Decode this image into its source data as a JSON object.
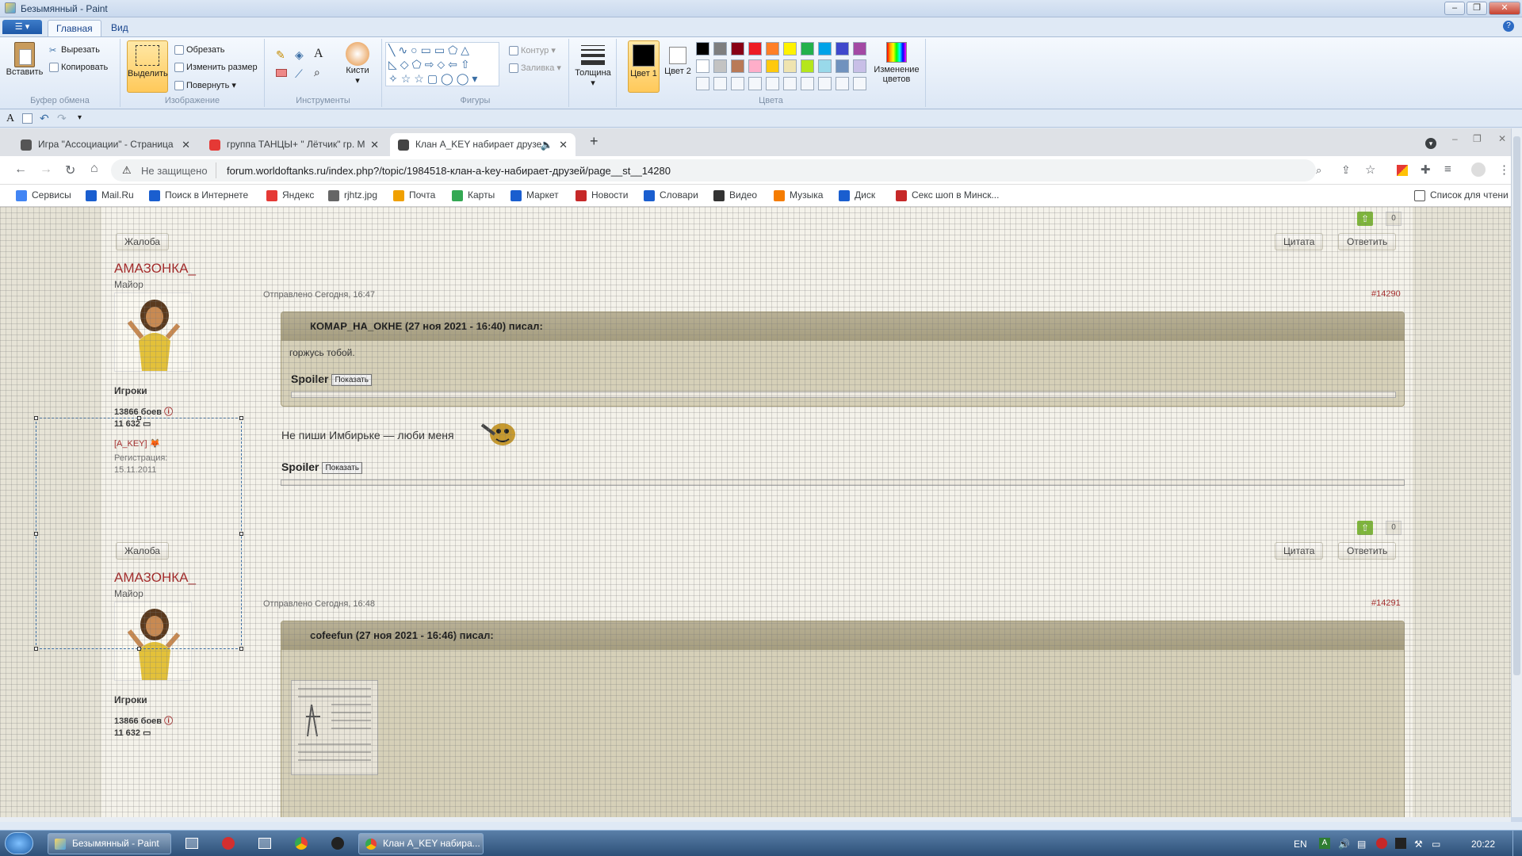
{
  "window": {
    "title": "Безымянный - Paint"
  },
  "ribbon": {
    "file_label": "▾",
    "tabs": [
      "Главная",
      "Вид"
    ],
    "clipboard": {
      "paste": "Вставить",
      "cut": "Вырезать",
      "copy": "Копировать",
      "group": "Буфер обмена"
    },
    "image": {
      "select": "Выделить",
      "crop": "Обрезать",
      "resize": "Изменить размер",
      "rotate": "Повернуть",
      "group": "Изображение"
    },
    "tools": {
      "group": "Инструменты",
      "brushes": "Кисти"
    },
    "shapes": {
      "outline": "Контур",
      "fill": "Заливка",
      "group": "Фигуры"
    },
    "size": {
      "label": "Толщина"
    },
    "colors": {
      "color1": "Цвет 1",
      "color2": "Цвет 2",
      "edit": "Изменение цветов",
      "group": "Цвета",
      "palette_row1": [
        "#000000",
        "#7f7f7f",
        "#880015",
        "#ed1c24",
        "#ff7f27",
        "#fff200",
        "#22b14c",
        "#00a2e8",
        "#3f48cc",
        "#a349a4"
      ],
      "palette_row2": [
        "#ffffff",
        "#c3c3c3",
        "#b97a57",
        "#ffaec9",
        "#ffc90e",
        "#efe4b0",
        "#b5e61d",
        "#99d9ea",
        "#7092be",
        "#c8bfe7"
      ]
    }
  },
  "browser": {
    "tabs": [
      {
        "title": "Игра \"Ассоциации\" - Страница",
        "color": "#555555"
      },
      {
        "title": "группа ТАНЦЫ+ \" Лётчик\" гр. М",
        "color": "#e53935"
      },
      {
        "title": "Клан A_KEY набирает друзе",
        "color": "#444444"
      }
    ],
    "security": "Не защищено",
    "url": "forum.worldoftanks.ru/index.php?/topic/1984518-клан-a-key-набирает-друзей/page__st__14280",
    "bookmarks": [
      {
        "label": "Сервисы",
        "color": "#4285f4"
      },
      {
        "label": "Mail.Ru",
        "color": "#1a5ecf"
      },
      {
        "label": "Поиск в Интернете",
        "color": "#1a5ecf"
      },
      {
        "label": "Яндекс",
        "color": "#e53935"
      },
      {
        "label": "rjhtz.jpg",
        "color": "#666666"
      },
      {
        "label": "Почта",
        "color": "#f0a000"
      },
      {
        "label": "Карты",
        "color": "#34a853"
      },
      {
        "label": "Маркет",
        "color": "#1a5ecf"
      },
      {
        "label": "Новости",
        "color": "#c62828"
      },
      {
        "label": "Словари",
        "color": "#1a5ecf"
      },
      {
        "label": "Видео",
        "color": "#333333"
      },
      {
        "label": "Музыка",
        "color": "#f57c00"
      },
      {
        "label": "Диск",
        "color": "#1a5ecf"
      },
      {
        "label": "Секс шоп в Минск...",
        "color": "#c62828"
      }
    ],
    "reading_list": "Список для чтени"
  },
  "forum": {
    "top": {
      "count": "0",
      "report": "Жалоба",
      "quote": "Цитата",
      "reply": "Ответить"
    },
    "posts": [
      {
        "author": "АМАЗОНКА_",
        "rank": "Майор",
        "group": "Игроки",
        "battles": "13866 боев",
        "posts": "11 632",
        "clan": "[A_KEY]",
        "reg_label": "Регистрация:",
        "reg_date": "15.11.2011",
        "sent": "Отправлено Сегодня, 16:47",
        "num": "#14290",
        "quote_header": "КОМАР_НА_ОКНЕ (27 ноя 2021 - 16:40) писал:",
        "quote_text": "горжусь тобой.",
        "spoiler": "Spoiler",
        "show": "Показать",
        "body": "Не пиши Имбирьке — люби меня",
        "count": "0",
        "report": "Жалоба",
        "quote": "Цитата",
        "reply": "Ответить"
      },
      {
        "author": "АМАЗОНКА_",
        "rank": "Майор",
        "group": "Игроки",
        "battles": "13866 боев",
        "posts": "11 632",
        "sent": "Отправлено Сегодня, 16:48",
        "num": "#14291",
        "quote_header": "cofeefun (27 ноя 2021 - 16:46) писал:"
      }
    ]
  },
  "taskbar": {
    "paint": "Безымянный - Paint",
    "chrome": "Клан A_KEY набира...",
    "lang": "EN",
    "time": "20:22"
  }
}
